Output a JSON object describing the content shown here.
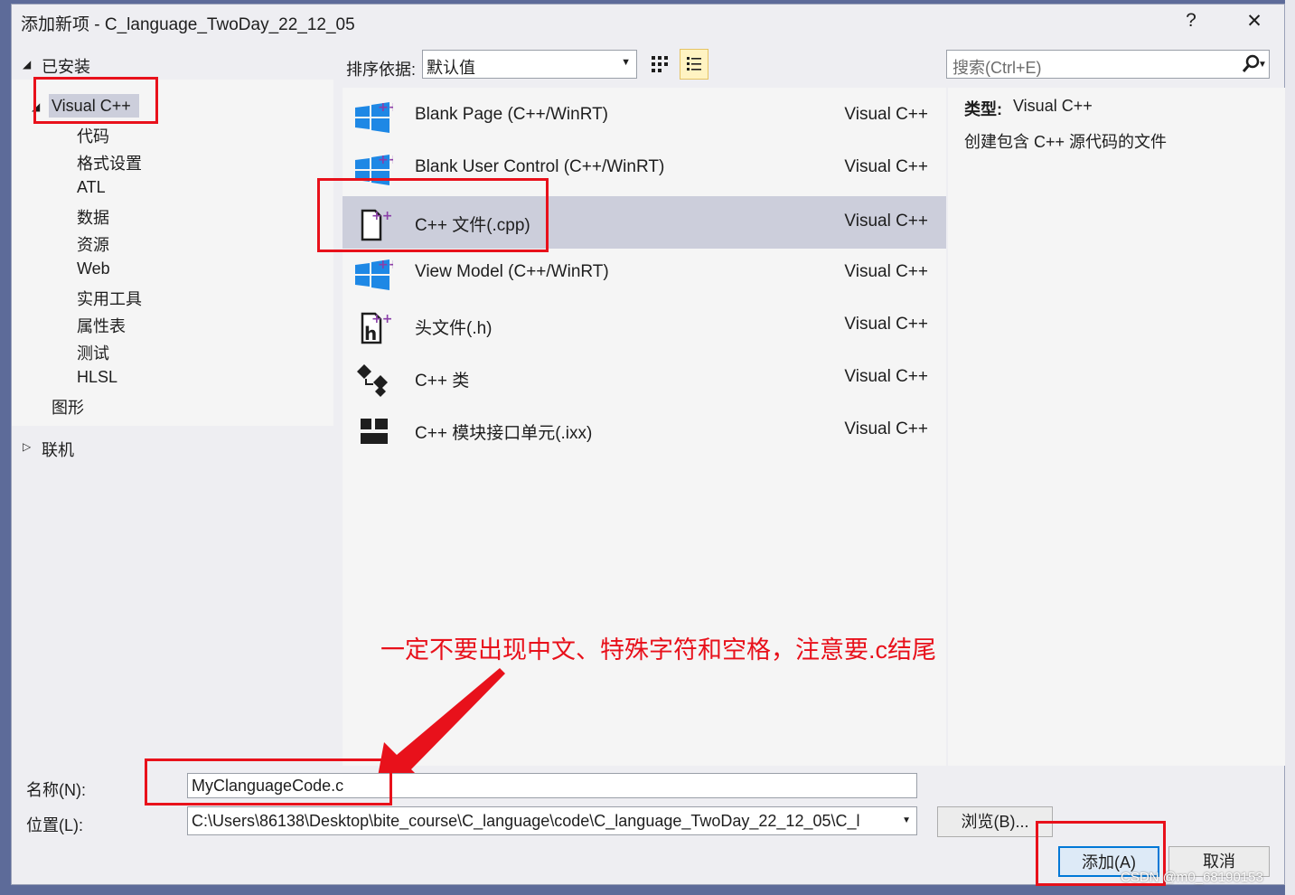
{
  "window": {
    "title": "添加新项 - C_language_TwoDay_22_12_05",
    "help_label": "?",
    "close_label": "✕"
  },
  "left": {
    "installed_label": "已安装",
    "visual_cpp_label": "Visual C++",
    "sub_items": [
      "代码",
      "格式设置",
      "ATL",
      "数据",
      "资源",
      "Web",
      "实用工具",
      "属性表",
      "测试",
      "HLSL"
    ],
    "graphics_label": "图形",
    "online_label": "联机"
  },
  "toolbar": {
    "sort_label": "排序依据:",
    "sort_value": "默认值",
    "search_placeholder": "搜索(Ctrl+E)"
  },
  "templates": [
    {
      "name": "Blank Page (C++/WinRT)",
      "type": "Visual C++",
      "icon": "windows-plus-icon"
    },
    {
      "name": "Blank User Control (C++/WinRT)",
      "type": "Visual C++",
      "icon": "windows-plus-icon"
    },
    {
      "name": "C++ 文件(.cpp)",
      "type": "Visual C++",
      "icon": "cpp-file-icon",
      "selected": true
    },
    {
      "name": "View Model (C++/WinRT)",
      "type": "Visual C++",
      "icon": "windows-plus-icon"
    },
    {
      "name": "头文件(.h)",
      "type": "Visual C++",
      "icon": "header-file-icon"
    },
    {
      "name": "C++ 类",
      "type": "Visual C++",
      "icon": "class-icon"
    },
    {
      "name": "C++ 模块接口单元(.ixx)",
      "type": "Visual C++",
      "icon": "module-icon"
    }
  ],
  "details": {
    "type_label": "类型:",
    "type_value": "Visual C++",
    "description": "创建包含 C++ 源代码的文件"
  },
  "annotation": "一定不要出现中文、特殊字符和空格，注意要.c结尾",
  "bottom": {
    "name_label": "名称(N):",
    "name_value": "MyClanguageCode.c",
    "location_label": "位置(L):",
    "location_value": "C:\\Users\\86138\\Desktop\\bite_course\\C_language\\code\\C_language_TwoDay_22_12_05\\C_l",
    "browse_label": "浏览(B)...",
    "add_label": "添加(A)",
    "cancel_label": "取消"
  },
  "watermark": "CSDN @m0_68190153",
  "colors": {
    "accent_red": "#e8111b",
    "selection": "#cccedb",
    "dialog_bg": "#eeeef2",
    "win_blue": "#1e88e5",
    "plus_purple": "#8a3fa8"
  }
}
